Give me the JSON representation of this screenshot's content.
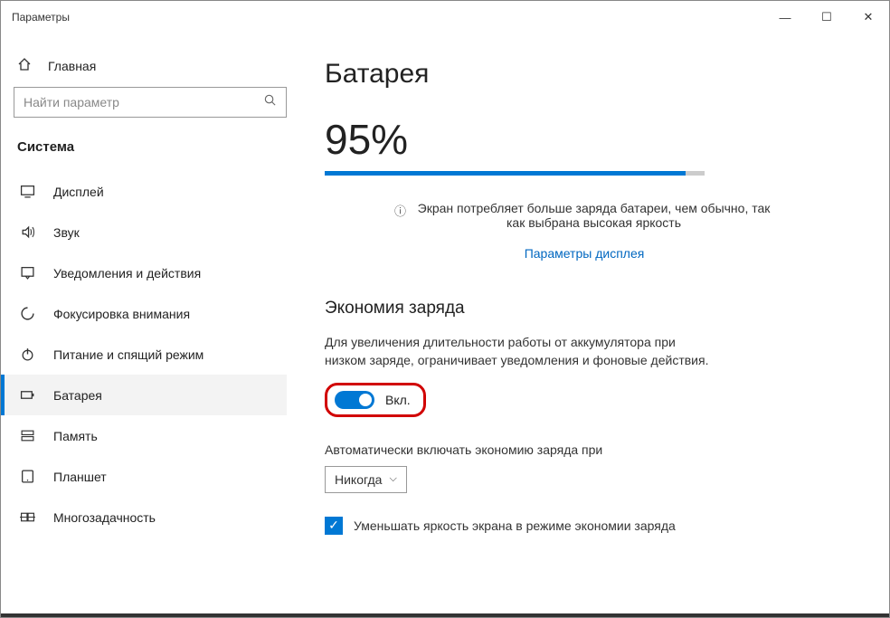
{
  "window": {
    "title": "Параметры"
  },
  "sidebar": {
    "home": "Главная",
    "search_placeholder": "Найти параметр",
    "category": "Система",
    "items": [
      {
        "label": "Дисплей",
        "icon": "display"
      },
      {
        "label": "Звук",
        "icon": "sound"
      },
      {
        "label": "Уведомления и действия",
        "icon": "notifications"
      },
      {
        "label": "Фокусировка внимания",
        "icon": "focus"
      },
      {
        "label": "Питание и спящий режим",
        "icon": "power"
      },
      {
        "label": "Батарея",
        "icon": "battery",
        "active": true
      },
      {
        "label": "Память",
        "icon": "storage"
      },
      {
        "label": "Планшет",
        "icon": "tablet"
      },
      {
        "label": "Многозадачность",
        "icon": "multitask"
      }
    ]
  },
  "main": {
    "title": "Батарея",
    "percent_text": "95%",
    "percent_value": 95,
    "info": "Экран потребляет больше заряда батареи, чем обычно, так как выбрана высокая яркость",
    "display_link": "Параметры дисплея",
    "saver_heading": "Экономия заряда",
    "saver_desc": "Для увеличения длительности работы от аккумулятора при низком заряде, ограничивает уведомления и фоновые действия.",
    "toggle_state": "Вкл.",
    "auto_label": "Автоматически включать экономию заряда при",
    "auto_value": "Никогда",
    "dim_label": "Уменьшать яркость экрана в режиме экономии заряда",
    "dim_checked": true
  }
}
